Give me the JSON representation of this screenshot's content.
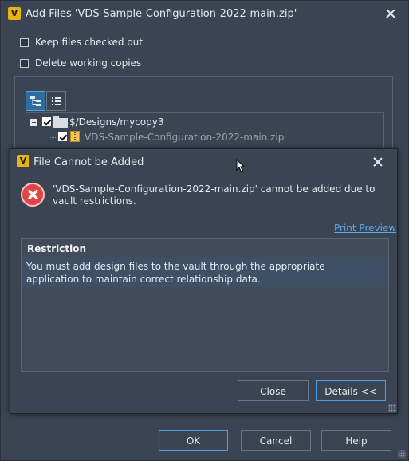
{
  "outer": {
    "title": "Add Files 'VDS-Sample-Configuration-2022-main.zip'",
    "logo_letter": "V",
    "options": [
      {
        "label": "Keep files checked out",
        "checked": false
      },
      {
        "label": "Delete working copies",
        "checked": false
      }
    ],
    "tree": {
      "folder_path": "$/Designs/mycopy3",
      "file_name": "VDS-Sample-Configuration-2022-main.zip"
    },
    "buttons": {
      "ok": "OK",
      "cancel": "Cancel",
      "help": "Help"
    }
  },
  "dialog": {
    "title": "File Cannot be Added",
    "logo_letter": "V",
    "message": "'VDS-Sample-Configuration-2022-main.zip' cannot be added due to vault restrictions.",
    "print_preview": "Print Preview",
    "restriction_header": "Restriction",
    "restrictions": [
      "You must add design files to the vault through the appropriate application to maintain correct relationship data."
    ],
    "buttons": {
      "close": "Close",
      "details": "Details <<"
    }
  },
  "colors": {
    "background": "#3b4453",
    "accent": "#4d9be0",
    "link": "#5aa8e8",
    "error": "#e04444",
    "selected_row": "#3d5066",
    "logo": "#e7b416"
  },
  "icons": [
    "app-logo-icon",
    "close-icon",
    "tree-view-icon",
    "list-view-icon",
    "expander-icon",
    "folder-icon",
    "zip-file-icon",
    "error-icon",
    "resize-grip-icon"
  ]
}
